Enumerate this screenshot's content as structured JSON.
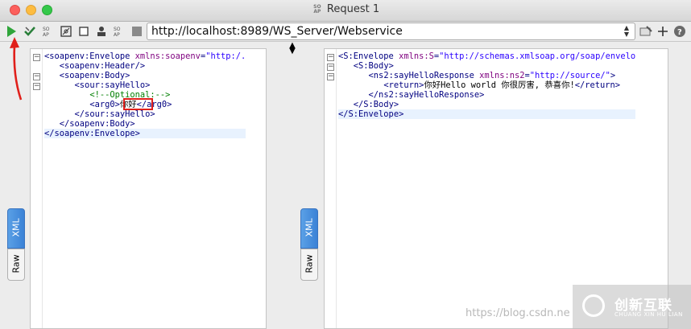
{
  "window": {
    "title": "Request 1",
    "soap_mark": "SO AP"
  },
  "toolbar": {
    "url": "http://localhost:8989/WS_Server/Webservice",
    "buttons": [
      {
        "name": "run-icon"
      },
      {
        "name": "add-assertion-icon"
      },
      {
        "name": "create-request-icon"
      },
      {
        "name": "format-icon"
      },
      {
        "name": "stop-icon"
      },
      {
        "name": "auth-icon"
      },
      {
        "name": "wsa-icon"
      },
      {
        "name": "options-icon"
      }
    ],
    "right_buttons": [
      {
        "name": "clear-icon"
      },
      {
        "name": "add-endpoint-icon"
      },
      {
        "name": "help-icon"
      }
    ]
  },
  "left_tabs": {
    "xml": "XML",
    "raw": "Raw"
  },
  "right_tabs": {
    "xml": "XML",
    "raw": "Raw"
  },
  "request_lines": [
    {
      "indent": "",
      "parts": [
        {
          "c": "tag",
          "t": "<soapenv:Envelope"
        },
        {
          "c": "attr",
          "t": " xmlns:soapenv"
        },
        {
          "c": "tag",
          "t": "="
        },
        {
          "c": "val",
          "t": "\"http:/."
        }
      ]
    },
    {
      "indent": "   ",
      "parts": [
        {
          "c": "tag",
          "t": "<soapenv:Header/>"
        }
      ]
    },
    {
      "indent": "   ",
      "parts": [
        {
          "c": "tag",
          "t": "<soapenv:Body>"
        }
      ]
    },
    {
      "indent": "      ",
      "parts": [
        {
          "c": "tag",
          "t": "<sour:sayHello>"
        }
      ]
    },
    {
      "indent": "         ",
      "parts": [
        {
          "c": "cm",
          "t": "<!--Optional:-->"
        }
      ]
    },
    {
      "indent": "         ",
      "parts": [
        {
          "c": "tag",
          "t": "<arg0>"
        },
        {
          "c": "txt",
          "t": "你好"
        },
        {
          "c": "tag",
          "t": "</arg0>"
        }
      ]
    },
    {
      "indent": "      ",
      "parts": [
        {
          "c": "tag",
          "t": "</sour:sayHello>"
        }
      ]
    },
    {
      "indent": "   ",
      "parts": [
        {
          "c": "tag",
          "t": "</soapenv:Body>"
        }
      ]
    },
    {
      "indent": "",
      "parts": [
        {
          "c": "tag",
          "t": "</soapenv:Envelope>"
        }
      ]
    }
  ],
  "response_lines": [
    {
      "indent": "",
      "parts": [
        {
          "c": "tag",
          "t": "<S:Envelope"
        },
        {
          "c": "attr",
          "t": " xmlns:S"
        },
        {
          "c": "tag",
          "t": "="
        },
        {
          "c": "val",
          "t": "\"http://schemas.xmlsoap.org/soap/envelo"
        }
      ]
    },
    {
      "indent": "   ",
      "parts": [
        {
          "c": "tag",
          "t": "<S:Body>"
        }
      ]
    },
    {
      "indent": "      ",
      "parts": [
        {
          "c": "tag",
          "t": "<ns2:sayHelloResponse"
        },
        {
          "c": "attr",
          "t": " xmlns:ns2"
        },
        {
          "c": "tag",
          "t": "="
        },
        {
          "c": "val",
          "t": "\"http://source/\""
        },
        {
          "c": "tag",
          "t": ">"
        }
      ]
    },
    {
      "indent": "         ",
      "parts": [
        {
          "c": "tag",
          "t": "<return>"
        },
        {
          "c": "txt",
          "t": "你好Hello world 你很厉害, 恭喜你!"
        },
        {
          "c": "tag",
          "t": "</return>"
        }
      ]
    },
    {
      "indent": "      ",
      "parts": [
        {
          "c": "tag",
          "t": "</ns2:sayHelloResponse>"
        }
      ]
    },
    {
      "indent": "   ",
      "parts": [
        {
          "c": "tag",
          "t": "</S:Body>"
        }
      ]
    },
    {
      "indent": "",
      "parts": [
        {
          "c": "tag",
          "t": "</S:Envelope>"
        }
      ]
    }
  ],
  "watermark": {
    "url": "https://blog.csdn.ne",
    "brand_cn": "创新互联",
    "brand_en": "CHUANG XIN HU LIAN"
  },
  "colors": {
    "annotation_red": "#e0201b",
    "run_green": "#2fa53a",
    "xml_tab_blue": "#3b82d6"
  }
}
